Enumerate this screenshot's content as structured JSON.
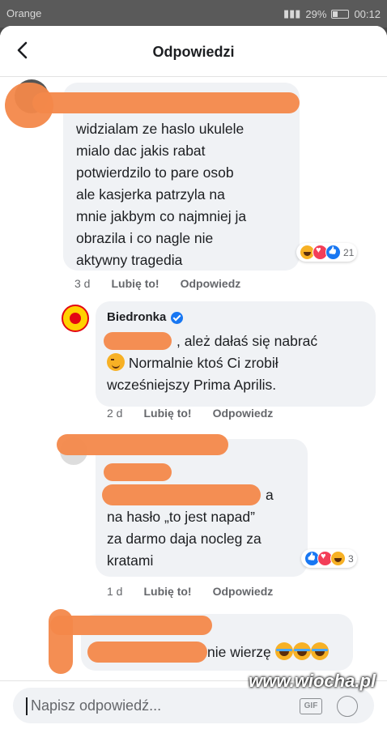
{
  "status_bar": {
    "carrier": "Orange",
    "battery": "29%",
    "time": "00:12"
  },
  "header": {
    "title": "Odpowiedzi"
  },
  "comments": [
    {
      "author": "",
      "lines": [
        "widzialam ze haslo ukulele",
        "mialo dac jakis rabat",
        "potwierdzilo to pare osob",
        "ale kasjerka patrzyla na",
        "mnie jakbym co najmniej ja",
        "obrazila i co nagle nie",
        "aktywny tragedia"
      ],
      "reactions": [
        "haha",
        "love",
        "like"
      ],
      "reaction_count": "21",
      "time": "3 d",
      "like_label": "Lubię to!",
      "reply_label": "Odpowiedz"
    },
    {
      "author": "Biedronka",
      "verified": true,
      "lines": [
        ", ależ dałaś się nabrać",
        "Normalnie ktoś Ci zrobił",
        "wcześniejszy Prima Aprilis."
      ],
      "time": "2 d",
      "like_label": "Lubię to!",
      "reply_label": "Odpowiedz"
    },
    {
      "author": "",
      "lines": [
        "a",
        "na hasło „to jest napad”",
        "za darmo daja nocleg za",
        "kratami"
      ],
      "reactions": [
        "like",
        "love",
        "haha"
      ],
      "reaction_count": "3",
      "time": "1 d",
      "like_label": "Lubię to!",
      "reply_label": "Odpowiedz"
    },
    {
      "author": "",
      "lines": [
        "nie wierzę"
      ]
    }
  ],
  "composer": {
    "placeholder": "Napisz odpowiedź...",
    "gif_label": "GIF"
  },
  "watermark": "www.wiocha.pl",
  "colors": {
    "redaction": "#f3884a",
    "bubble": "#f0f2f5",
    "accent": "#1877f2"
  }
}
